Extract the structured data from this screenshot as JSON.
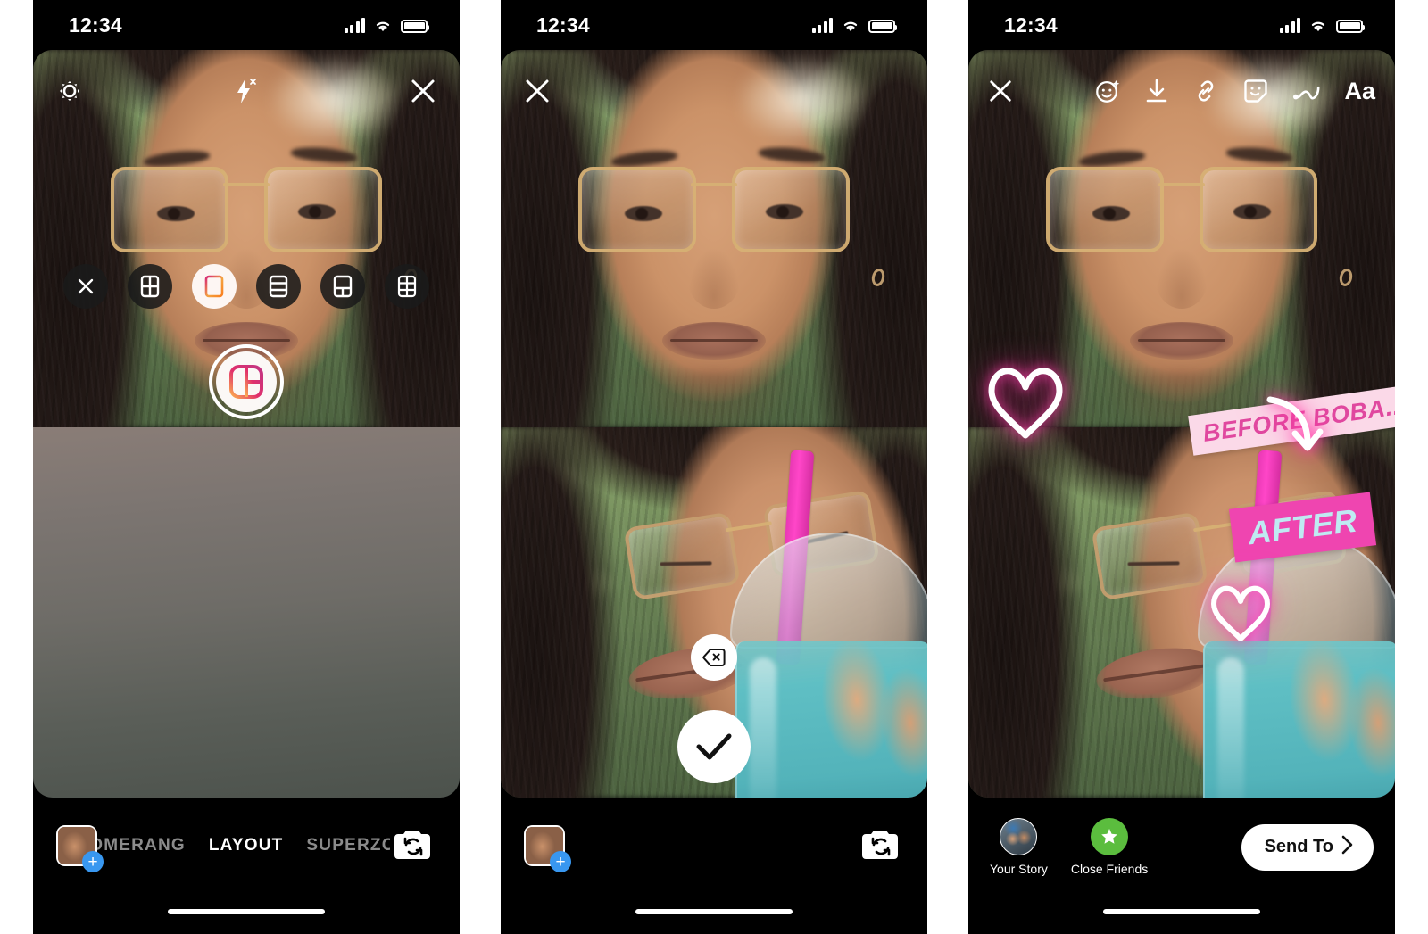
{
  "statusbar": {
    "time": "12:34",
    "signal_icon": "cellular-bars-icon",
    "wifi_icon": "wifi-icon",
    "battery_icon": "battery-icon"
  },
  "phone1": {
    "name": "instagram-layout-capture-screen",
    "top": {
      "settings_icon": "gear-icon",
      "flash_icon": "flash-off-icon",
      "close_icon": "close-icon"
    },
    "layout_options": [
      {
        "name": "layout-close",
        "icon": "close-icon",
        "selected": false
      },
      {
        "name": "layout-2-vertical",
        "icon": "grid-2-vertical-icon",
        "selected": false
      },
      {
        "name": "layout-2-horizontal",
        "icon": "grid-2-horizontal-icon",
        "selected": true
      },
      {
        "name": "layout-3-horizontal",
        "icon": "grid-3-horizontal-icon",
        "selected": false
      },
      {
        "name": "layout-1-top-2-bottom",
        "icon": "grid-1-top-2-bottom-icon",
        "selected": false
      },
      {
        "name": "layout-6-grid",
        "icon": "grid-6-icon",
        "selected": false
      }
    ],
    "shutter": {
      "name": "shutter-button",
      "icon": "layout-grid-gradient-icon"
    },
    "bottom": {
      "gallery_thumb": "gallery-thumbnail",
      "add_badge": "+",
      "modes": [
        {
          "label": "BOOMERANG",
          "active": false
        },
        {
          "label": "LAYOUT",
          "active": true
        },
        {
          "label": "SUPERZOOM",
          "active": false
        }
      ],
      "flip_icon": "camera-flip-icon"
    }
  },
  "phone2": {
    "name": "instagram-layout-review-screen",
    "top": {
      "close_icon": "close-icon"
    },
    "controls": {
      "delete_icon": "backspace-delete-icon",
      "confirm_icon": "checkmark-icon"
    },
    "bottom": {
      "gallery_thumb": "gallery-thumbnail",
      "add_badge": "+",
      "flip_icon": "camera-flip-icon"
    }
  },
  "phone3": {
    "name": "instagram-story-editor-screen",
    "top": {
      "close_icon": "close-icon",
      "tools": [
        {
          "name": "effects-icon",
          "glyph": "face-sparkle-icon"
        },
        {
          "name": "download-icon",
          "glyph": "download-arrow-icon"
        },
        {
          "name": "link-icon",
          "glyph": "chain-link-icon"
        },
        {
          "name": "sticker-icon",
          "glyph": "sticker-smiley-icon"
        },
        {
          "name": "draw-icon",
          "glyph": "squiggle-pen-icon"
        },
        {
          "name": "text-icon",
          "glyph": "Aa"
        }
      ]
    },
    "stickers": {
      "before_text": "BEFORE BOBA...",
      "after_text": "AFTER",
      "heart_large": "neon-heart-icon",
      "heart_small": "neon-heart-icon",
      "arrow": "neon-curved-arrow-icon"
    },
    "share": {
      "your_story_label": "Your Story",
      "close_friends_label": "Close Friends",
      "close_friends_icon": "green-star-icon",
      "send_to_label": "Send To",
      "send_to_chevron": "chevron-right-icon"
    }
  },
  "colors": {
    "accent_blue": "#3897f0",
    "sticker_pink_bg": "#fbd9e8",
    "sticker_pink_text": "#e0489f",
    "sticker_magenta_bg": "#ef45b0",
    "sticker_cyan_text": "#bfeaf2",
    "close_friends_green": "#5bbd3e",
    "neon_glow": "#ff40ac"
  }
}
